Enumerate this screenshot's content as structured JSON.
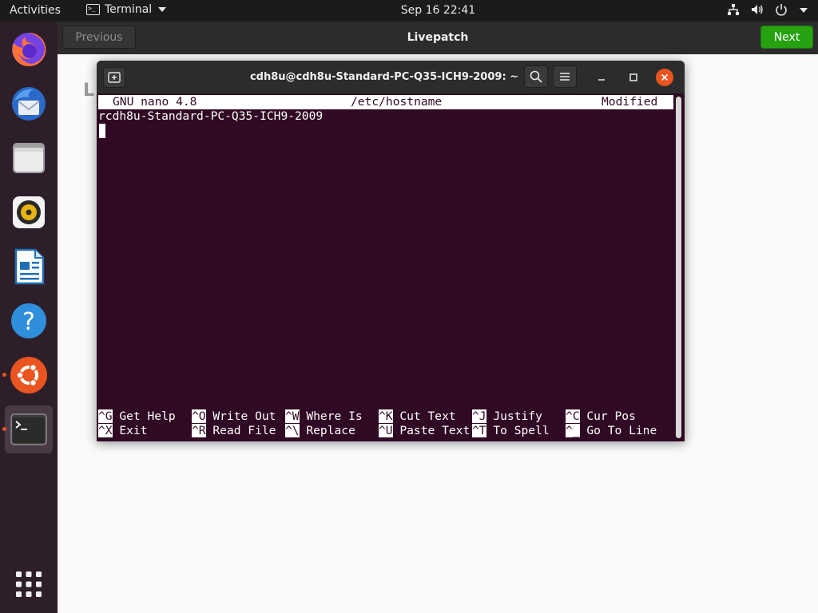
{
  "topbar": {
    "activities": "Activities",
    "app_name": "Terminal",
    "clock": "Sep 16  22:41"
  },
  "dock": {
    "items": [
      {
        "name": "firefox"
      },
      {
        "name": "thunderbird"
      },
      {
        "name": "files"
      },
      {
        "name": "rhythmbox"
      },
      {
        "name": "libreoffice-writer"
      },
      {
        "name": "help"
      },
      {
        "name": "ubuntu-software"
      },
      {
        "name": "terminal"
      },
      {
        "name": "show-applications"
      }
    ]
  },
  "wizard": {
    "previous_label": "Previous",
    "title": "Livepatch",
    "next_label": "Next",
    "heading_partial": "L"
  },
  "terminal": {
    "title": "cdh8u@cdh8u-Standard-PC-Q35-ICH9-2009: ~"
  },
  "nano": {
    "version": "GNU nano 4.8",
    "filename": "/etc/hostname",
    "state": "Modified",
    "content_line": "rcdh8u-Standard-PC-Q35-ICH9-2009",
    "shortcuts_row1": [
      {
        "key": "^G",
        "label": " Get Help"
      },
      {
        "key": "^O",
        "label": " Write Out"
      },
      {
        "key": "^W",
        "label": " Where Is"
      },
      {
        "key": "^K",
        "label": " Cut Text"
      },
      {
        "key": "^J",
        "label": " Justify"
      },
      {
        "key": "^C",
        "label": " Cur Pos"
      }
    ],
    "shortcuts_row2": [
      {
        "key": "^X",
        "label": " Exit"
      },
      {
        "key": "^R",
        "label": " Read File"
      },
      {
        "key": "^\\",
        "label": " Replace"
      },
      {
        "key": "^U",
        "label": " Paste Text"
      },
      {
        "key": "^T",
        "label": " To Spell"
      },
      {
        "key": "^_",
        "label": " Go To Line"
      }
    ]
  }
}
